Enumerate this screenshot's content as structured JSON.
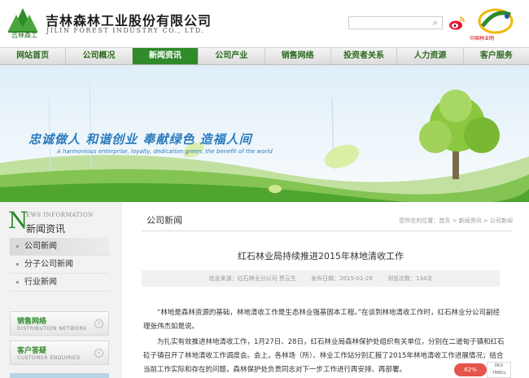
{
  "header": {
    "company_cn": "吉林森林工业股份有限公司",
    "company_en": "JILIN FOREST INDUSTRY CO., LTD.",
    "logo_text": "吉林森工",
    "search": {
      "value": "",
      "icon": "search-icon"
    },
    "weibo_icon": "weibo-icon",
    "forestry_label": "中国林业网"
  },
  "nav": {
    "items": [
      "网站首页",
      "公司概况",
      "新闻资讯",
      "公司产业",
      "销售网络",
      "投资者关系",
      "人力资源",
      "客户服务"
    ],
    "active_index": 2,
    "active_color": "#2f8a2a"
  },
  "banner": {
    "slogan": "忠诚做人 和谐创业 奉献绿色 造福人间",
    "sub": "A harmonious enterprise, loyalty, dedication green, the benefit of the world"
  },
  "sidebar": {
    "title_letter": "N",
    "title_en": "EWS INFORMATION",
    "title_cn": "新闻资讯",
    "items": [
      "公司新闻",
      "分子公司新闻",
      "行业新闻"
    ],
    "active_index": 0,
    "cards": [
      {
        "cn": "销售网络",
        "en": "DISTRIBUTION NETWORK"
      },
      {
        "cn": "客户答疑",
        "en": "CUSTOMER ENQUIRIES"
      }
    ]
  },
  "main": {
    "section_title": "公司新闻",
    "breadcrumb": "您所在的位置：首页 > 新闻资讯 > 公司新闻",
    "article_title": "红石林业局持续推进2015年林地清收工作",
    "meta": {
      "source": "信息来源：红石林业分公司 贾云生",
      "date": "发布日期：2015-01-29",
      "views": "浏览次数：134次"
    },
    "paragraphs": [
      "“林地是森林资源的基础，林地清收工作是生态林业强基固本工程。”在谈到林地清收工作时，红石林业分公司副经理张伟杰如是说。",
      "为扎实有效推进林地清收工作，1月27日、28日，红石林业局森林保护处组织有关单位，分别在二道甸子镇和红石砬子镇召开了林地清收工作调度会。会上，各林场（所）、林业工作站分别汇报了2015年林地清收工作进展情况；结合当前工作实际和存在的问题，森林保护处负责同志对下一步工作进行再安排、再部署。"
    ],
    "badge_left": "62%",
    "badge_right_top": "0K/s",
    "badge_right_bottom": "788K/s"
  }
}
